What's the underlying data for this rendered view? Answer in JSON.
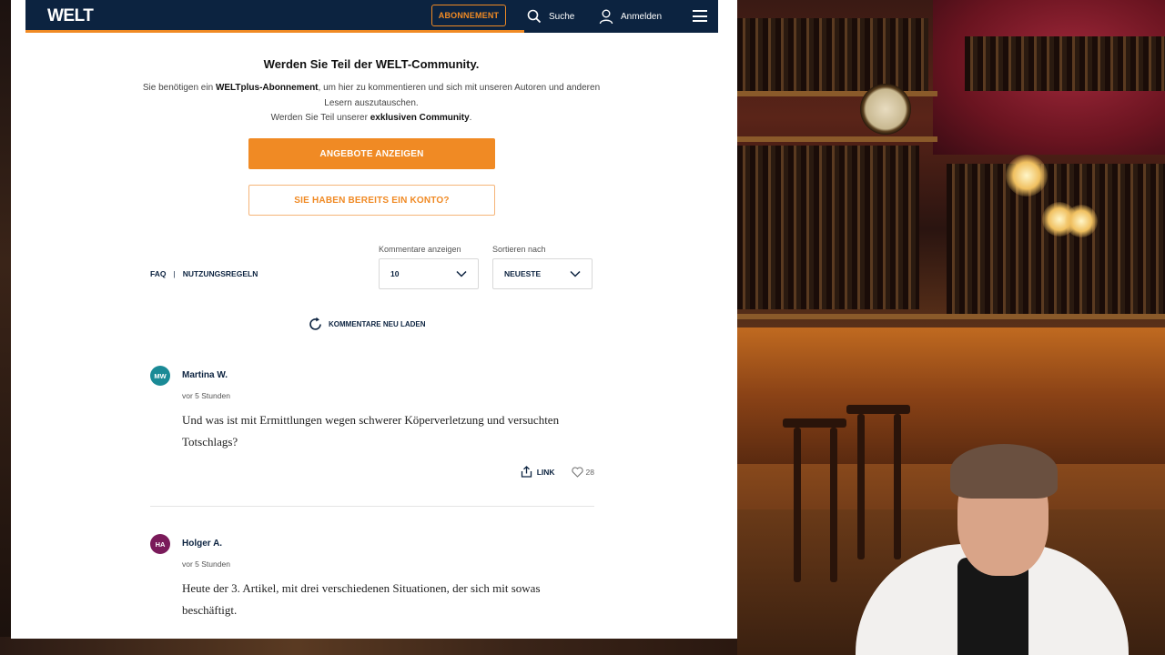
{
  "header": {
    "logo": "WELT",
    "subscribe_label": "ABONNEMENT",
    "search_label": "Suche",
    "login_label": "Anmelden"
  },
  "community": {
    "title": "Werden Sie Teil der WELT-Community.",
    "text_part1": "Sie benötigen ein ",
    "text_bold1": "WELTplus-Abonnement",
    "text_part2": ", um hier zu kommentieren und sich mit unseren Autoren und anderen Lesern auszutauschen.",
    "text_part3": "Werden Sie Teil unserer ",
    "text_bold2": "exklusiven Community",
    "text_part4": ".",
    "offers_button": "ANGEBOTE ANZEIGEN",
    "account_button": "SIE HABEN BEREITS EIN KONTO?"
  },
  "controls": {
    "faq": "FAQ",
    "separator": "|",
    "rules": "NUTZUNGSREGELN",
    "show_label": "Kommentare anzeigen",
    "show_value": "10",
    "sort_label": "Sortieren nach",
    "sort_value": "NEUESTE",
    "reload_label": "KOMMENTARE NEU LADEN"
  },
  "comments": [
    {
      "initials": "MW",
      "avatar_color": "#1a8a96",
      "name": "Martina W.",
      "time": "vor 5 Stunden",
      "text": "Und was ist mit Ermittlungen wegen schwerer Köperverletzung und versuchten Totschlags?",
      "link_label": "LINK",
      "likes": "28"
    },
    {
      "initials": "HA",
      "avatar_color": "#7a1a5a",
      "name": "Holger A.",
      "time": "vor 5 Stunden",
      "text": "Heute der 3. Artikel, mit drei verschiedenen Situationen, der sich mit sowas beschäftigt."
    }
  ],
  "colors": {
    "brand_navy": "#0c2340",
    "accent_orange": "#f08a24"
  }
}
